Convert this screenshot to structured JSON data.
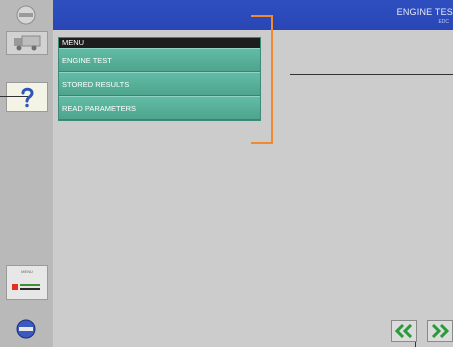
{
  "header": {
    "title": "ENGINE TES",
    "subtitle": "EDC"
  },
  "menu": {
    "title": "MENU",
    "items": [
      {
        "label": "ENGINE TEST"
      },
      {
        "label": "STORED RESULTS"
      },
      {
        "label": "READ PARAMETERS"
      }
    ]
  },
  "sidebar": {
    "buttons": [
      "stop-icon",
      "truck-icon",
      "help-question-icon",
      "status-indicator-icon",
      "exit-icon"
    ],
    "status_panel_label": "MENU"
  },
  "navigation": {
    "back_icon": "double-chevron-left-icon",
    "forward_icon": "double-chevron-right-icon"
  },
  "colors": {
    "header_blue": "#2c4ab8",
    "menu_green": "#4fa992",
    "callout_orange": "#f08a2c",
    "nav_arrow_green": "#2a9a3a"
  }
}
